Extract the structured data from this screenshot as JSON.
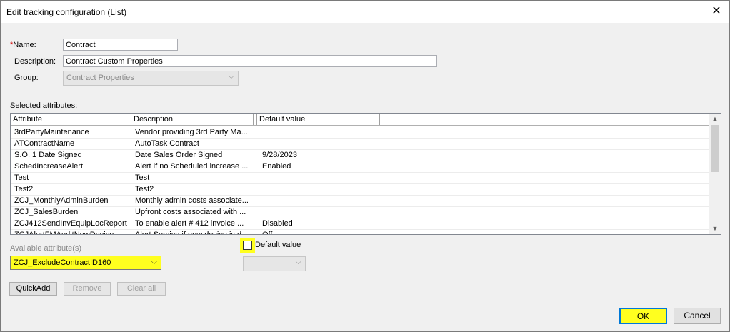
{
  "window": {
    "title": "Edit tracking configuration (List)",
    "close_glyph": "✕"
  },
  "form": {
    "name_label": "Name:",
    "name_required_mark": "*",
    "name_value": "Contract",
    "description_label": "Description:",
    "description_value": "Contract Custom Properties",
    "group_label": "Group:",
    "group_value": "Contract Properties"
  },
  "selected": {
    "label": "Selected attributes:",
    "columns": [
      "Attribute",
      "Description",
      "Default value"
    ],
    "rows": [
      {
        "attribute": "3rdPartyMaintenance",
        "description": "Vendor providing 3rd Party Ma...",
        "default": ""
      },
      {
        "attribute": "ATContractName",
        "description": "AutoTask Contract",
        "default": ""
      },
      {
        "attribute": "S.O. 1 Date Signed",
        "description": "Date Sales Order Signed",
        "default": "9/28/2023"
      },
      {
        "attribute": "SchedIncreaseAlert",
        "description": "Alert if no Scheduled increase ...",
        "default": "Enabled"
      },
      {
        "attribute": "Test",
        "description": "Test",
        "default": ""
      },
      {
        "attribute": "Test2",
        "description": "Test2",
        "default": ""
      },
      {
        "attribute": "ZCJ_MonthlyAdminBurden",
        "description": "Monthly admin costs associate...",
        "default": ""
      },
      {
        "attribute": "ZCJ_SalesBurden",
        "description": "Upfront costs associated with ...",
        "default": ""
      },
      {
        "attribute": "ZCJ412SendInvEquipLocReport",
        "description": "To enable alert # 412 invoice ...",
        "default": "Disabled"
      },
      {
        "attribute": "ZCJAlertFMAuditNewDevice",
        "description": "Alert Service if new device is d...",
        "default": "Off"
      }
    ]
  },
  "available": {
    "label": "Available attribute(s)",
    "selected_value": "ZCJ_ExcludeContractID160"
  },
  "default_value": {
    "label": "Default value",
    "checked": false
  },
  "buttons": {
    "quickadd": "QuickAdd",
    "remove": "Remove",
    "clear_all": "Clear all",
    "ok": "OK",
    "cancel": "Cancel"
  },
  "colors": {
    "highlight": "#ffff1f",
    "focus_border": "#0078d7"
  }
}
